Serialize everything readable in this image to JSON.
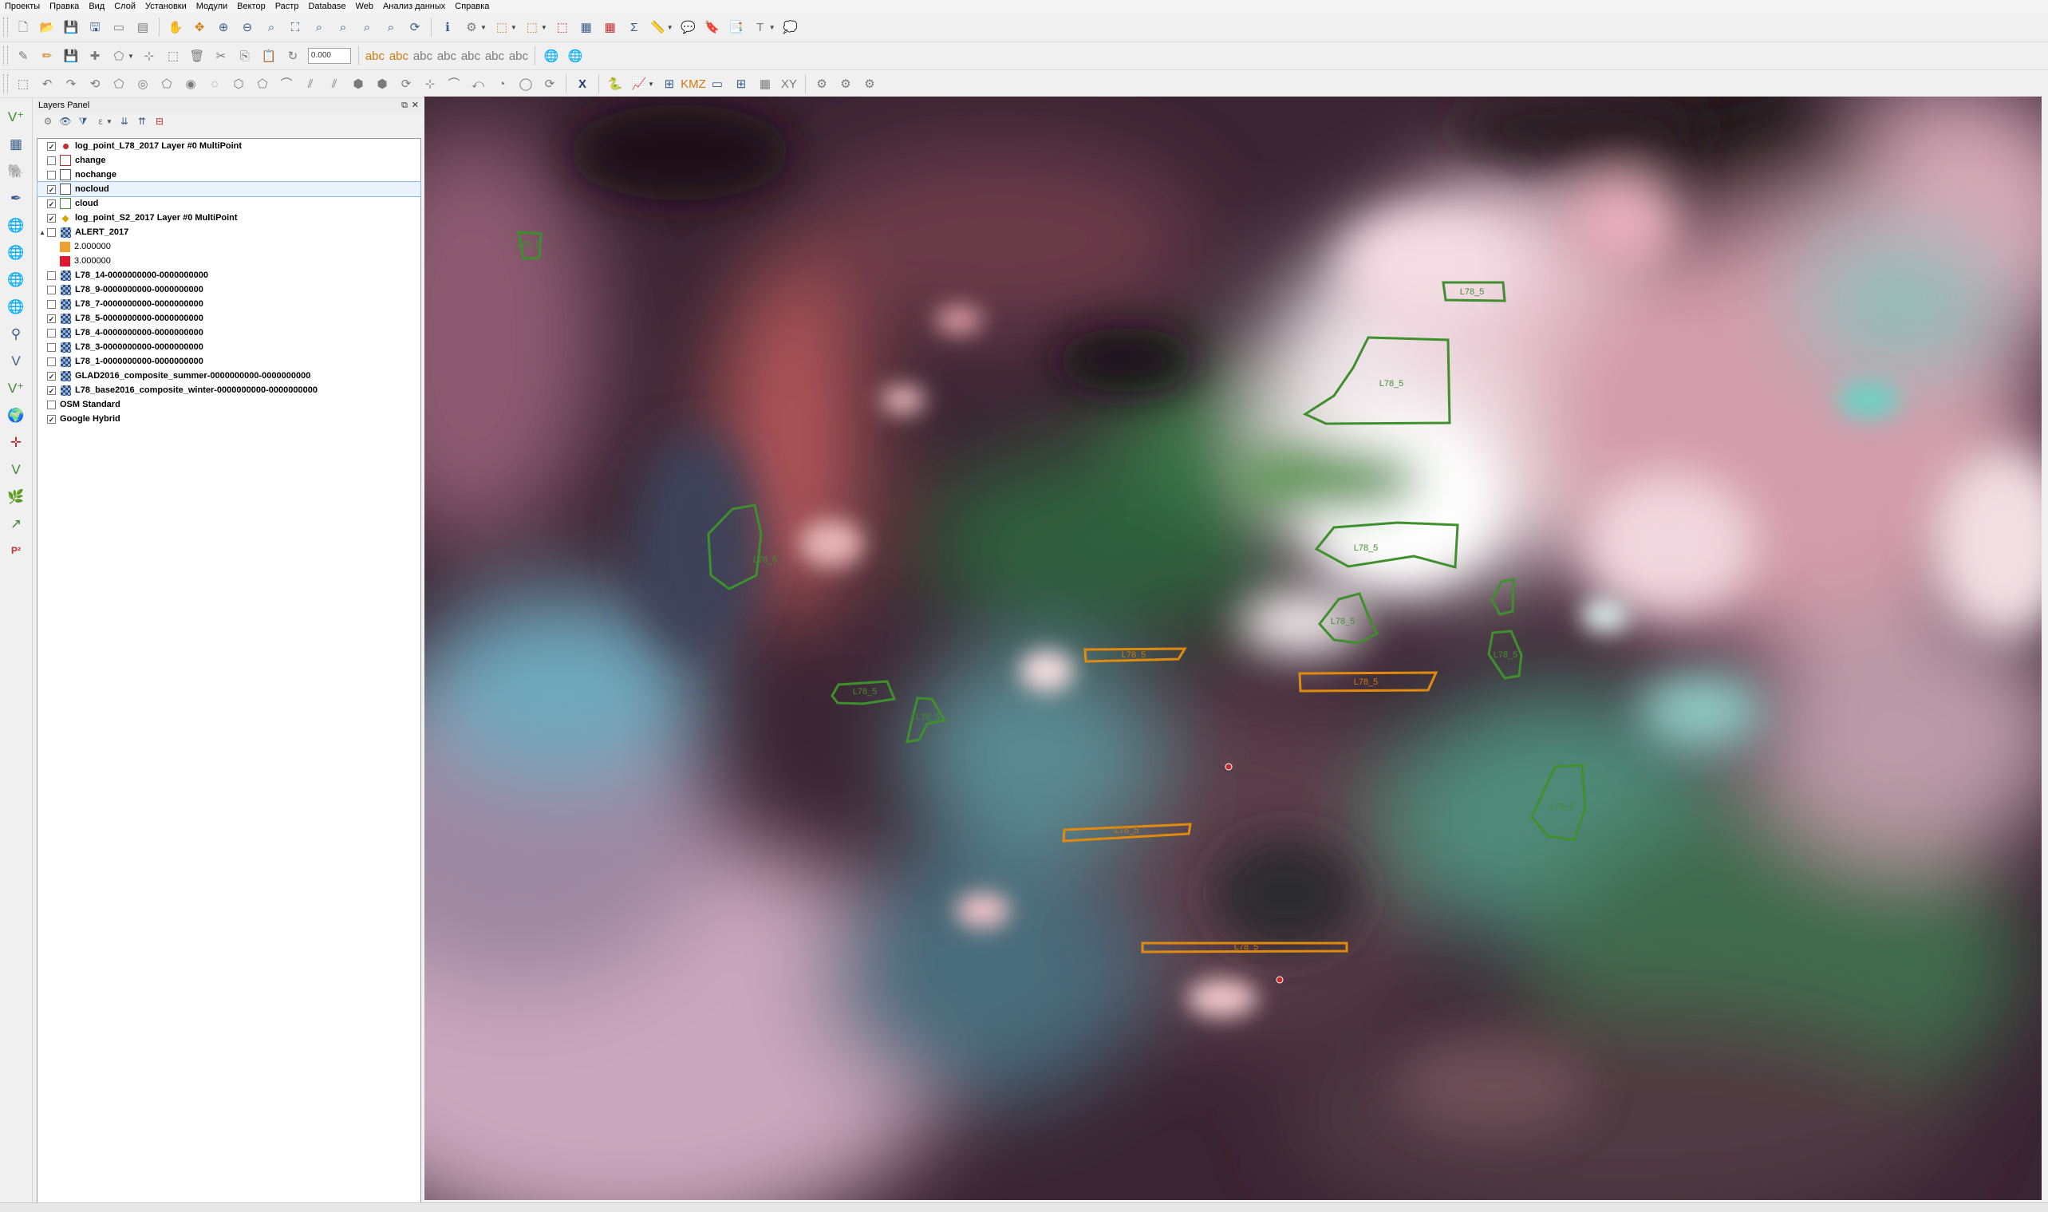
{
  "menu": [
    "Проекты",
    "Правка",
    "Вид",
    "Слой",
    "Установки",
    "Модули",
    "Вектор",
    "Растр",
    "Database",
    "Web",
    "Анализ данных",
    "Справка"
  ],
  "toolbar": {
    "scale_value": "0.000"
  },
  "layers_panel": {
    "title": "Layers Panel",
    "layers": [
      {
        "name": "log_point_L78_2017 Layer #0 MultiPoint",
        "checked": true,
        "symbol": "point",
        "color": "#c62a2a"
      },
      {
        "name": "change",
        "checked": false,
        "symbol": "polygon",
        "color": "#c62a2a"
      },
      {
        "name": "nochange",
        "checked": false,
        "symbol": "polygon",
        "color": "#555555"
      },
      {
        "name": "nocloud",
        "checked": true,
        "symbol": "polygon",
        "color": "#555555",
        "selected": true
      },
      {
        "name": "cloud",
        "checked": true,
        "symbol": "polygon",
        "color": "#3f8f2e"
      },
      {
        "name": "log_point_S2_2017 Layer #0 MultiPoint",
        "checked": true,
        "symbol": "star",
        "color": "#d6a400"
      },
      {
        "name": "ALERT_2017",
        "checked": false,
        "symbol": "raster",
        "expanded": true,
        "legend": [
          {
            "label": "2.000000",
            "color": "#f0a030"
          },
          {
            "label": "3.000000",
            "color": "#e0182f"
          }
        ]
      },
      {
        "name": "L78_14-0000000000-0000000000",
        "checked": false,
        "symbol": "raster"
      },
      {
        "name": "L78_9-0000000000-0000000000",
        "checked": false,
        "symbol": "raster"
      },
      {
        "name": "L78_7-0000000000-0000000000",
        "checked": false,
        "symbol": "raster"
      },
      {
        "name": "L78_5-0000000000-0000000000",
        "checked": true,
        "symbol": "raster"
      },
      {
        "name": "L78_4-0000000000-0000000000",
        "checked": false,
        "symbol": "raster"
      },
      {
        "name": "L78_3-0000000000-0000000000",
        "checked": false,
        "symbol": "raster"
      },
      {
        "name": "L78_1-0000000000-0000000000",
        "checked": false,
        "symbol": "raster"
      },
      {
        "name": "GLAD2016_composite_summer-0000000000-0000000000",
        "checked": true,
        "symbol": "raster"
      },
      {
        "name": "L78_base2016_composite_winter-0000000000-0000000000",
        "checked": true,
        "symbol": "raster"
      },
      {
        "name": "OSM Standard",
        "checked": false,
        "symbol": "none"
      },
      {
        "name": "Google Hybrid",
        "checked": true,
        "symbol": "none"
      }
    ]
  },
  "map": {
    "feature_label": "L78_5",
    "colors": {
      "cloud_outline": "#3f8f2e",
      "change_outline": "#e08a10",
      "log_point": "#c62a2a"
    }
  }
}
